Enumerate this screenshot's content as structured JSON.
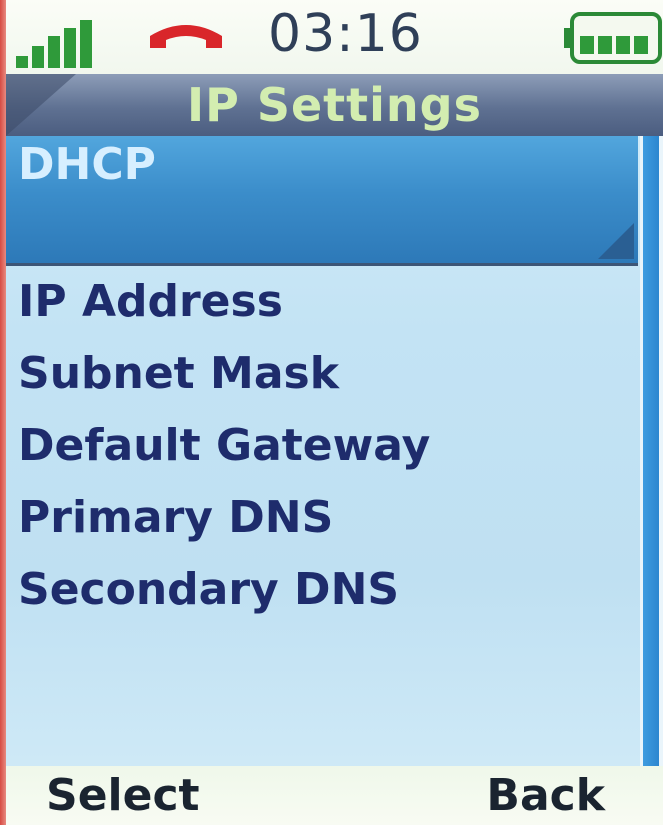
{
  "status_bar": {
    "time": "03:16",
    "icons": [
      "signal-strength-icon",
      "call-end-icon",
      "battery-icon"
    ],
    "colors": {
      "signal": "#2f9a3a",
      "call_end": "#d9262a",
      "battery": "#2f9a3a"
    }
  },
  "header": {
    "title": "IP Settings"
  },
  "menu": {
    "items": [
      {
        "label": "DHCP",
        "selected": true
      },
      {
        "label": "IP Address",
        "selected": false
      },
      {
        "label": "Subnet Mask",
        "selected": false
      },
      {
        "label": "Default Gateway",
        "selected": false
      },
      {
        "label": "Primary DNS",
        "selected": false
      },
      {
        "label": "Secondary DNS",
        "selected": false
      }
    ]
  },
  "softkeys": {
    "left": "Select",
    "right": "Back"
  },
  "theme": {
    "selection": "#3b8dca",
    "item_text": "#1e2c6c",
    "title_text": "#d3edb0"
  }
}
